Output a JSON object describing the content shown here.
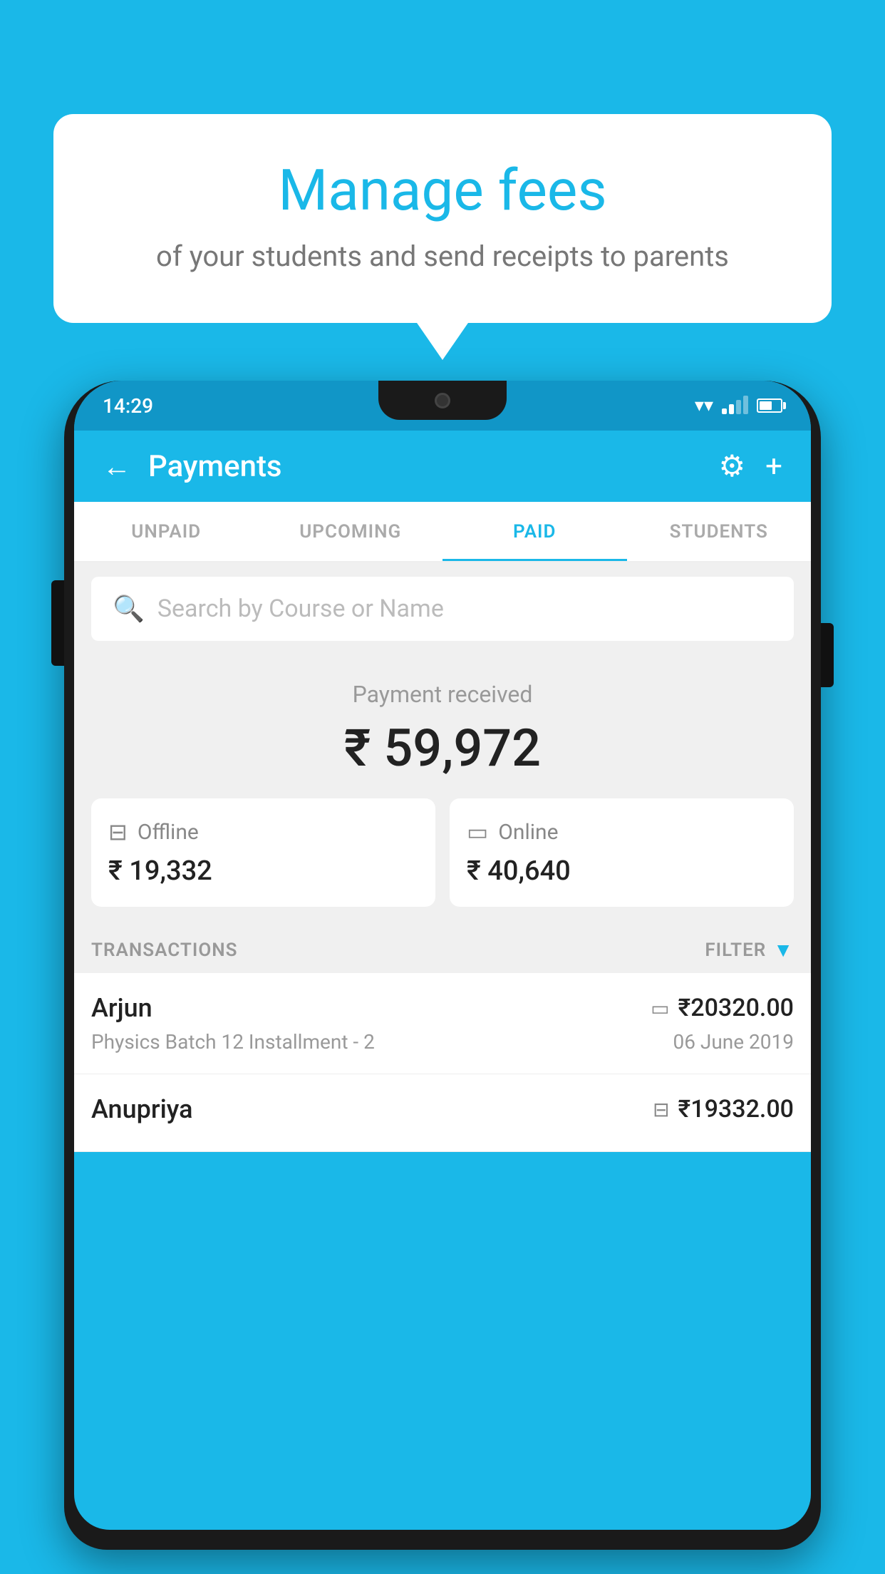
{
  "background_color": "#1ab8e8",
  "speech_bubble": {
    "title": "Manage fees",
    "subtitle": "of your students and send receipts to parents"
  },
  "status_bar": {
    "time": "14:29"
  },
  "app_header": {
    "title": "Payments",
    "back_icon": "←",
    "gear_icon": "⚙",
    "plus_icon": "+"
  },
  "tabs": [
    {
      "label": "UNPAID",
      "active": false
    },
    {
      "label": "UPCOMING",
      "active": false
    },
    {
      "label": "PAID",
      "active": true
    },
    {
      "label": "STUDENTS",
      "active": false
    }
  ],
  "search": {
    "placeholder": "Search by Course or Name"
  },
  "payment_received": {
    "label": "Payment received",
    "amount": "₹ 59,972"
  },
  "payment_cards": [
    {
      "label": "Offline",
      "amount": "₹ 19,332",
      "icon": "offline"
    },
    {
      "label": "Online",
      "amount": "₹ 40,640",
      "icon": "online"
    }
  ],
  "transactions_section": {
    "label": "TRANSACTIONS",
    "filter_label": "FILTER"
  },
  "transactions": [
    {
      "name": "Arjun",
      "description": "Physics Batch 12 Installment - 2",
      "amount": "₹20320.00",
      "date": "06 June 2019",
      "payment_type": "online"
    },
    {
      "name": "Anupriya",
      "description": "",
      "amount": "₹19332.00",
      "date": "",
      "payment_type": "offline"
    }
  ]
}
